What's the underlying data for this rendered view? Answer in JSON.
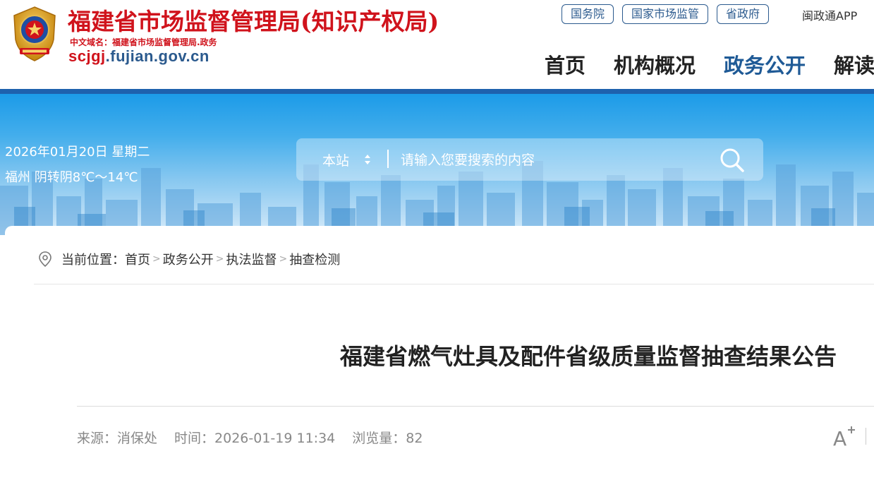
{
  "header": {
    "site_title": "福建省市场监督管理局(知识产权局)",
    "cn_domain": "中文域名：福建省市场监督管理局.政务",
    "domain_prefix": "scjgj",
    "domain_suffix": ".fujian.gov.cn",
    "emblem_icon": "police-emblem-icon",
    "top_links": [
      "国务院",
      "国家市场监管",
      "省政府"
    ],
    "app_link": "闽政通APP",
    "nav": [
      "首页",
      "机构概况",
      "政务公开",
      "解读"
    ],
    "nav_active": "政务公开",
    "colors": {
      "title_red": "#d0131c",
      "nav_blue": "#1f5a96",
      "stripe": "#1e61ad"
    }
  },
  "banner": {
    "date": "2026年01月20日 星期二",
    "weather": "福州 阴转阴8℃～14℃",
    "search": {
      "scope": "本站",
      "placeholder": "请输入您要搜索的内容",
      "scope_icon": "sort-arrows-icon",
      "button_icon": "search-icon"
    }
  },
  "breadcrumb": {
    "label": "当前位置：",
    "icon": "location-pin-icon",
    "items": [
      "首页",
      "政务公开",
      "执法监督",
      "抽查检测"
    ],
    "separator": ">"
  },
  "article": {
    "title": "福建省燃气灶具及配件省级质量监督抽查结果公告",
    "source_label": "来源：",
    "source": "消保处",
    "time_label": "时间：",
    "time": "2026-01-19 11:34",
    "views_label": "浏览量：",
    "views": "82",
    "font_button_icon": "font-size-increase-icon"
  }
}
